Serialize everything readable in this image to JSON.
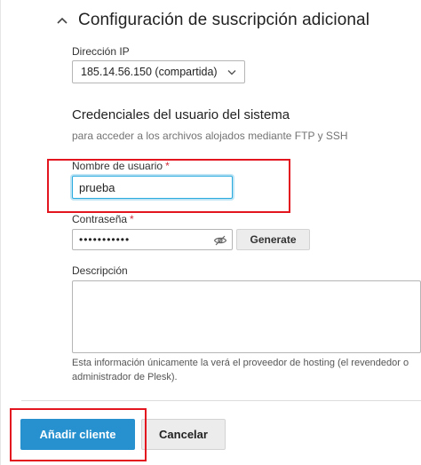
{
  "section": {
    "title": "Configuración de suscripción adicional",
    "collapse_icon": "chevron-up-icon"
  },
  "ip": {
    "label": "Dirección IP",
    "selected": "185.14.56.150 (compartida)",
    "dropdown_icon": "chevron-down-icon"
  },
  "credentials": {
    "heading": "Credenciales del usuario del sistema",
    "hint": "para acceder a los archivos alojados mediante FTP y SSH",
    "username_label": "Nombre de usuario",
    "username_value": "prueba",
    "password_label": "Contraseña",
    "password_value": "•••••••••••",
    "visibility_icon": "eye-slash-icon",
    "generate_label": "Generate",
    "required_mark": "*"
  },
  "description": {
    "label": "Descripción",
    "value": "",
    "note": "Esta información únicamente la verá el proveedor de hosting (el revendedor o administrador de Plesk)."
  },
  "actions": {
    "submit_label": "Añadir cliente",
    "cancel_label": "Cancelar"
  },
  "colors": {
    "primary": "#2791cf",
    "focus": "#28aade",
    "required": "#d02d3c",
    "annotation": "#e3161f"
  }
}
